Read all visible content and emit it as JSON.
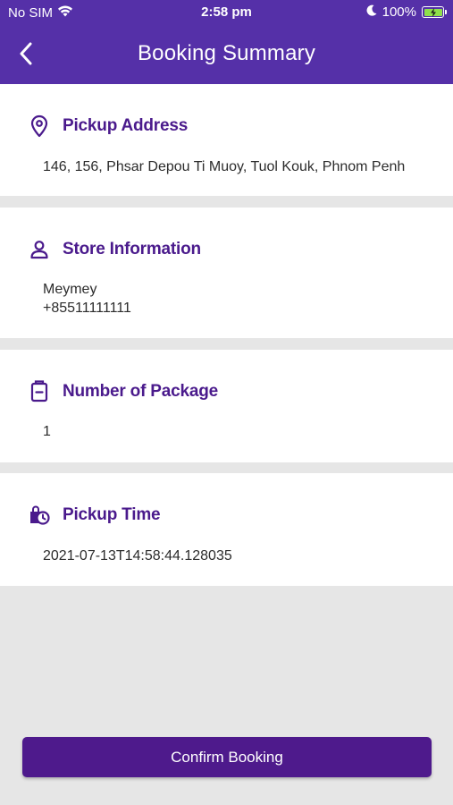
{
  "status_bar": {
    "carrier": "No SIM",
    "time": "2:58 pm",
    "battery": "100%",
    "icons": [
      "wifi-icon",
      "moon-icon",
      "battery-charging-icon"
    ]
  },
  "nav": {
    "title": "Booking Summary",
    "back_icon": "chevron-left-icon"
  },
  "sections": {
    "pickup_address": {
      "title": "Pickup Address",
      "icon": "location-pin-icon",
      "value": "146, 156, Phsar Depou Ti Muoy, Tuol Kouk, Phnom Penh"
    },
    "store_information": {
      "title": "Store Information",
      "icon": "user-icon",
      "name": "Meymey",
      "phone": "+85511111111"
    },
    "number_of_package": {
      "title": "Number of Package",
      "icon": "package-icon",
      "value": "1"
    },
    "pickup_time": {
      "title": "Pickup Time",
      "icon": "bag-clock-icon",
      "value": "2021-07-13T14:58:44.128035"
    }
  },
  "actions": {
    "confirm_label": "Confirm Booking"
  },
  "colors": {
    "header": "#5530a8",
    "accent": "#4a1a8c",
    "button": "#4e1a8c",
    "background": "#e6e6e6"
  }
}
